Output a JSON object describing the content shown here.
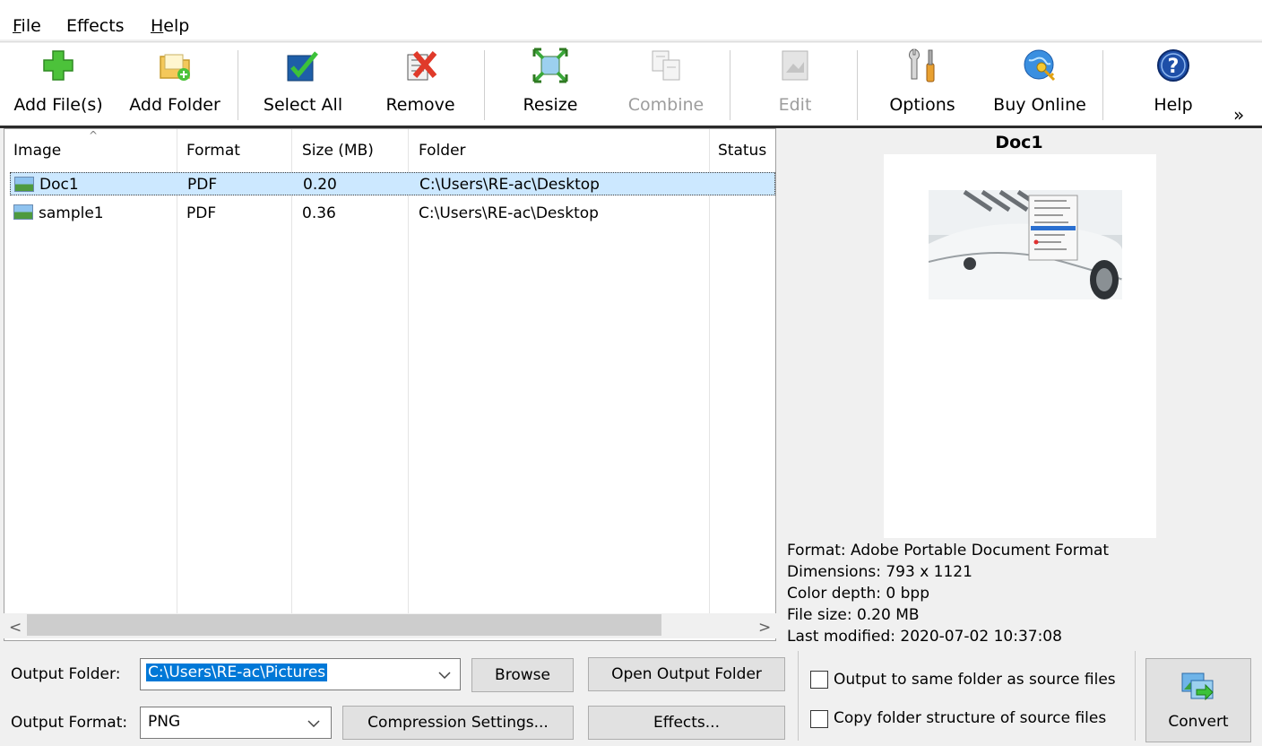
{
  "menu": {
    "file": {
      "acc": "F",
      "rest": "ile"
    },
    "effects": "Effects",
    "help": {
      "acc": "H",
      "rest": "elp"
    }
  },
  "toolbar": {
    "add_files": "Add File(s)",
    "add_folder": "Add Folder",
    "select_all": "Select All",
    "remove": "Remove",
    "resize": "Resize",
    "combine": "Combine",
    "edit": "Edit",
    "options": "Options",
    "buy_online": "Buy Online",
    "help": "Help",
    "more": "»"
  },
  "list": {
    "columns": [
      "Image",
      "Format",
      "Size (MB)",
      "Folder",
      "Status"
    ],
    "sort_indicator": "^",
    "rows": [
      {
        "image": "Doc1",
        "format": "PDF",
        "size": "0.20",
        "folder": "C:\\Users\\RE-ac\\Desktop",
        "status": ""
      },
      {
        "image": "sample1",
        "format": "PDF",
        "size": "0.36",
        "folder": "C:\\Users\\RE-ac\\Desktop",
        "status": ""
      }
    ],
    "scroll_left": "<",
    "scroll_right": ">"
  },
  "preview": {
    "title": "Doc1",
    "format_line": "Format: Adobe Portable Document Format",
    "dimensions_line": "Dimensions: 793 x 1121",
    "color_depth_line": "Color depth: 0 bpp",
    "file_size_line": "File size: 0.20 MB",
    "last_modified_line": "Last modified: 2020-07-02 10:37:08"
  },
  "output": {
    "folder_label": "Output Folder:",
    "folder_value": "C:\\Users\\RE-ac\\Pictures",
    "browse": "Browse",
    "open_output_folder": "Open Output Folder",
    "format_label": "Output Format:",
    "format_value": "PNG",
    "compression_settings": "Compression Settings...",
    "effects": "Effects...",
    "same_folder": "Output to same folder as source files",
    "copy_structure": "Copy folder structure of source files",
    "convert": "Convert"
  },
  "colors": {
    "selection": "#cce8ff",
    "input_highlight": "#0078d7"
  }
}
